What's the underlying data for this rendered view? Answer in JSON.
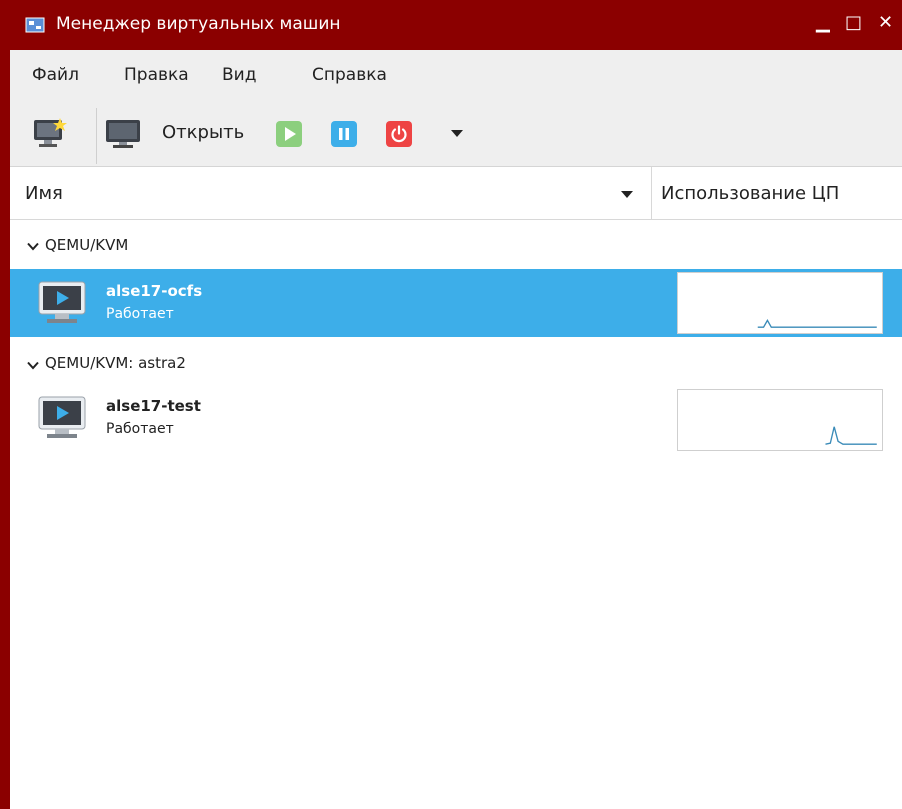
{
  "window": {
    "title": "Менеджер виртуальных машин"
  },
  "menu": [
    "Файл",
    "Правка",
    "Вид",
    "Справка"
  ],
  "toolbar": {
    "open_label": "Открыть"
  },
  "columns": {
    "name": "Имя",
    "cpu": "Использование ЦП"
  },
  "groups": [
    {
      "label": "QEMU/KVM",
      "vms": [
        {
          "name": "alse17-ocfs",
          "status": "Работает",
          "selected": true
        }
      ]
    },
    {
      "label": "QEMU/KVM: astra2",
      "vms": [
        {
          "name": "alse17-test",
          "status": "Работает",
          "selected": false
        }
      ]
    }
  ],
  "colors": {
    "title_bar": "#8b0000",
    "selection": "#3daee9",
    "run": "#8ccf7e",
    "pause": "#3daee9",
    "power": "#ee4444"
  }
}
